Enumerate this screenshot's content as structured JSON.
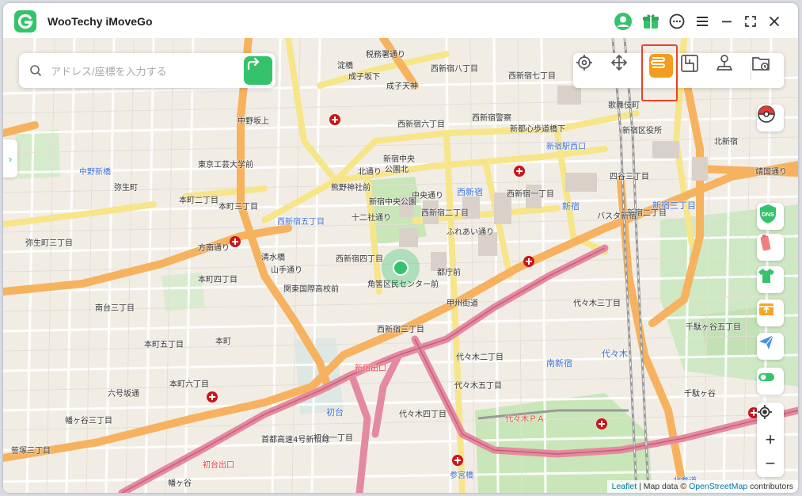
{
  "app": {
    "title": "WooTechy iMoveGo"
  },
  "titlebar": {
    "icons": [
      "avatar-icon",
      "gift-icon",
      "chat-icon",
      "menu-icon",
      "minimize-icon",
      "fullscreen-icon",
      "close-icon"
    ]
  },
  "search": {
    "placeholder": "アドレス/座標を入力する",
    "value": ""
  },
  "modes": {
    "items": [
      "teleport-mode-icon",
      "joystick-mode-icon",
      "multi-spot-mode-icon",
      "two-spot-mode-icon",
      "jump-teleport-icon",
      "history-icon"
    ],
    "active": "multi-spot-mode-icon"
  },
  "side_tools": [
    "pokeball-icon",
    "dns-icon",
    "battery-icon",
    "shirt-icon",
    "import-gpx-icon",
    "send-icon",
    "toggle-icon"
  ],
  "zoom": {
    "plus": "+",
    "minus": "−"
  },
  "attribution": {
    "leaflet": "Leaflet",
    "mid": " | Map data © ",
    "osm": "OpenStreetMap",
    "tail": " contributors"
  },
  "colors": {
    "brand_green": "#34c36b",
    "active_orange": "#f39c1f",
    "highlight_red": "#e8432a"
  },
  "map_labels": [
    {
      "t": "税務署通り"
    },
    {
      "t": "淀橋"
    },
    {
      "t": "西新宿八丁目"
    },
    {
      "t": "成子坂下"
    },
    {
      "t": "成子天神"
    },
    {
      "t": "西新宿七丁目"
    },
    {
      "t": "西新宿六丁目"
    },
    {
      "t": "西新宿警察"
    },
    {
      "t": "新都心歩道橋下"
    },
    {
      "t": "新宿中央"
    },
    {
      "t": "公園北"
    },
    {
      "t": "北通り"
    },
    {
      "t": "中央通り"
    },
    {
      "t": "西新宿"
    },
    {
      "t": "新宿中央公園"
    },
    {
      "t": "熊野神社前"
    },
    {
      "t": "十二社通り"
    },
    {
      "t": "西新宿五丁目"
    },
    {
      "t": "西新宿二丁目"
    },
    {
      "t": "ふれあい通り"
    },
    {
      "t": "西新宿四丁目"
    },
    {
      "t": "都庁前"
    },
    {
      "t": "角筈区民センター前"
    },
    {
      "t": "西新宿三丁目"
    },
    {
      "t": "新宿出口"
    },
    {
      "t": "新宿三丁目"
    },
    {
      "t": "代々木"
    },
    {
      "t": "南新宿"
    },
    {
      "t": "初台"
    },
    {
      "t": "初台出口"
    },
    {
      "t": "首都高速4号新宿線"
    },
    {
      "t": "方南通り"
    },
    {
      "t": "甲州街道"
    },
    {
      "t": "山手通り"
    },
    {
      "t": "中野新橋"
    },
    {
      "t": "弥生町"
    },
    {
      "t": "本町"
    },
    {
      "t": "幡ヶ谷"
    },
    {
      "t": "参宮橋"
    },
    {
      "t": "北参道"
    },
    {
      "t": "千駄ヶ谷"
    },
    {
      "t": "新宿"
    },
    {
      "t": "西新宿一丁目"
    },
    {
      "t": "代々木三丁目"
    },
    {
      "t": "代々木二丁目"
    },
    {
      "t": "歌舞伎町"
    },
    {
      "t": "新宿区役所"
    },
    {
      "t": "東京工芸大学前"
    },
    {
      "t": "清水橋"
    },
    {
      "t": "関東国際高校前"
    },
    {
      "t": "六号坂通"
    },
    {
      "t": "代々木ＰＡ"
    },
    {
      "t": "新宿二丁目"
    },
    {
      "t": "四谷三丁目"
    },
    {
      "t": "靖国通り"
    },
    {
      "t": "新宿駅西口"
    },
    {
      "t": "バスタ新宿"
    },
    {
      "t": "弥生町三丁目"
    },
    {
      "t": "本町二丁目"
    },
    {
      "t": "本町三丁目"
    },
    {
      "t": "本町四丁目"
    },
    {
      "t": "本町五丁目"
    },
    {
      "t": "本町六丁目"
    },
    {
      "t": "南台三丁目"
    },
    {
      "t": "幡ヶ谷三丁目"
    },
    {
      "t": "笹塚三丁目"
    },
    {
      "t": "初台一丁目"
    },
    {
      "t": "代々木四丁目"
    },
    {
      "t": "代々木五丁目"
    },
    {
      "t": "千駄ヶ谷五丁目"
    },
    {
      "t": "北新宿"
    },
    {
      "t": "中野坂上"
    }
  ]
}
